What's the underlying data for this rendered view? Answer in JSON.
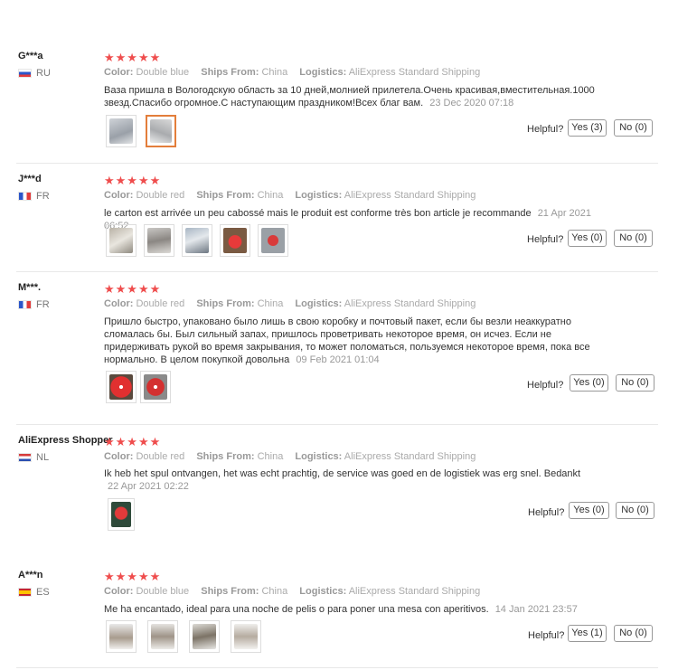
{
  "labels": {
    "color": "Color:",
    "ships_from": "Ships From:",
    "logistics": "Logistics:",
    "helpful": "Helpful?"
  },
  "reviews": [
    {
      "user": "G***a",
      "country": "RU",
      "stars": "★★★★★",
      "color": "Double blue",
      "ships_from": "China",
      "logistics": "AliExpress Standard Shipping",
      "text": "Ваза пришла в Вологодскую область за 10 дней,молнией прилетела.Очень красивая,вместительная.1000 звезд.Спасибо огромное.С наступающим праздником!Всех благ вам.",
      "date": "23 Dec 2020 07:18",
      "yes": "Yes (3)",
      "no": "No (0)"
    },
    {
      "user": "J***d",
      "country": "FR",
      "stars": "★★★★★",
      "color": "Double red",
      "ships_from": "China",
      "logistics": "AliExpress Standard Shipping",
      "text": "le carton est arrivée un peu cabossé mais le produit est conforme très bon article je recommande",
      "date": "21 Apr 2021 06:52",
      "yes": "Yes (0)",
      "no": "No (0)"
    },
    {
      "user": "M***.",
      "country": "FR",
      "stars": "★★★★★",
      "color": "Double red",
      "ships_from": "China",
      "logistics": "AliExpress Standard Shipping",
      "text": "Пришло быстро, упаковано было лишь в свою коробку и почтовый пакет, если бы везли неаккуратно сломалась бы. Был сильный запах, пришлось проветривать некоторое время, он исчез. Если не придерживать рукой во время закрывания, то может поломаться, пользуемся некоторое время, пока все нормально. В целом покупкой довольна",
      "date": "09 Feb 2021 01:04",
      "yes": "Yes (0)",
      "no": "No (0)"
    },
    {
      "user": "AliExpress Shopper",
      "country": "NL",
      "stars": "★★★★★",
      "color": "Double red",
      "ships_from": "China",
      "logistics": "AliExpress Standard Shipping",
      "text": "Ik heb het spul ontvangen, het was echt prachtig, de service was goed en de logistiek was erg snel. Bedankt",
      "date": "22 Apr 2021 02:22",
      "yes": "Yes (0)",
      "no": "No (0)"
    },
    {
      "user": "A***n",
      "country": "ES",
      "stars": "★★★★★",
      "color": "Double blue",
      "ships_from": "China",
      "logistics": "AliExpress Standard Shipping",
      "text": "Me ha encantado, ideal para una noche de pelis o para poner una mesa con aperitivos.",
      "date": "14 Jan 2021 23:57",
      "yes": "Yes (1)",
      "no": "No (0)"
    }
  ]
}
